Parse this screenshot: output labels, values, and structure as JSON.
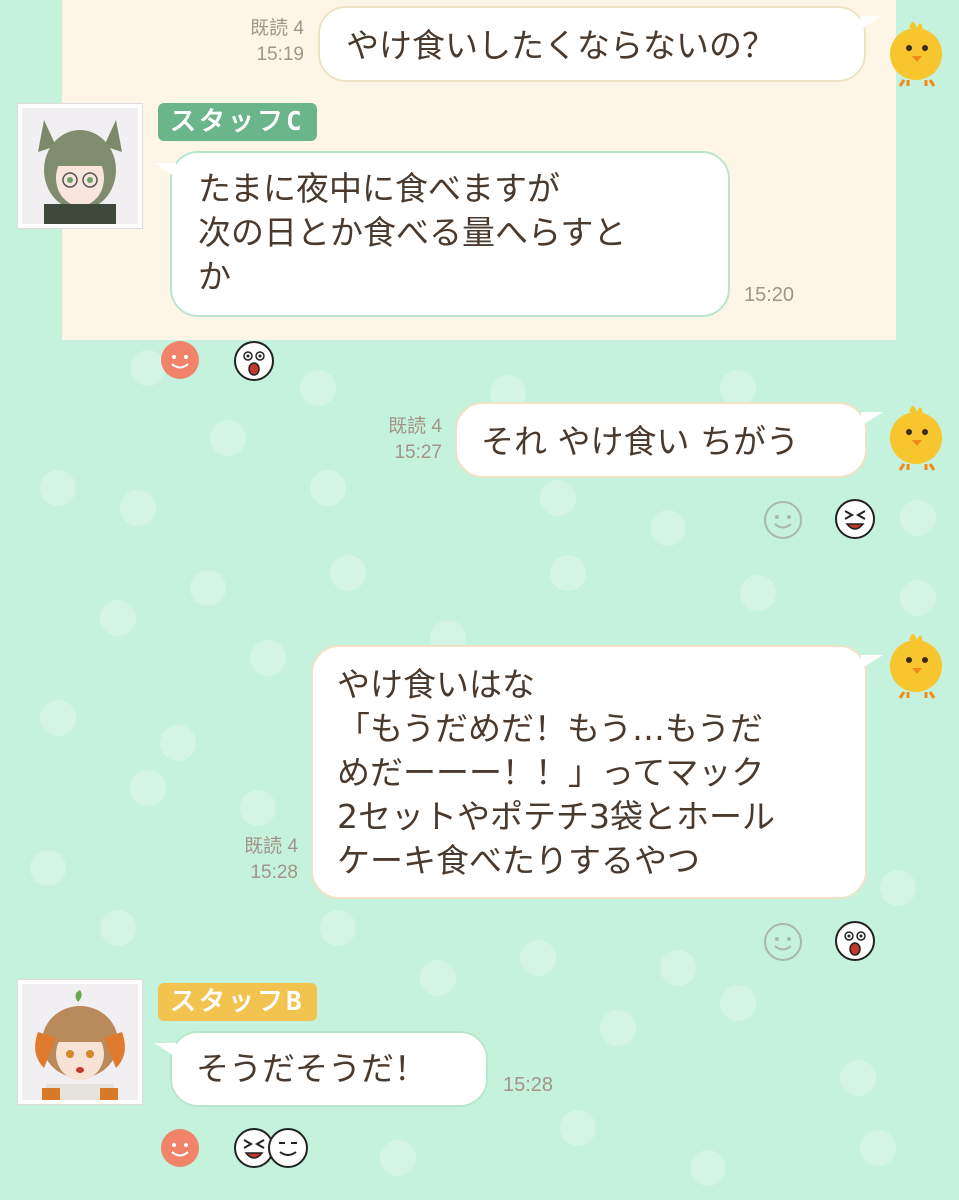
{
  "theme": {
    "background": "#c4f2dc",
    "highlight": "#fdf6e6",
    "bubble": "#ffffff",
    "staff_c_tag": "#6bb58a",
    "staff_b_tag": "#f2c34e",
    "reaction_orange": "#f0836a"
  },
  "messages": [
    {
      "sender": "self",
      "read": "既読 4",
      "time": "15:19",
      "lines": [
        "やけ食いしたくならないの？"
      ]
    },
    {
      "sender": "スタッフC",
      "time": "15:20",
      "lines": [
        "たまに夜中に食べますが",
        "次の日とか食べる量へらすと",
        "か"
      ]
    },
    {
      "sender": "self",
      "read": "既読 4",
      "time": "15:27",
      "lines": [
        "それ やけ食い ちがう"
      ]
    },
    {
      "sender": "self",
      "read": "既読 4",
      "time": "15:28",
      "lines": [
        "やけ食いはな",
        "「もうだめだ！もう…もうだ",
        "めだーーー！！」ってマック",
        "2セットやポテチ3袋とホール",
        "ケーキ食べたりするやつ"
      ]
    },
    {
      "sender": "スタッフB",
      "time": "15:28",
      "lines": [
        "そうだそうだ！"
      ]
    }
  ],
  "reactions": [
    {
      "after": "スタッフC",
      "icons": [
        "smile-icon",
        "shocked-face-icon"
      ]
    },
    {
      "after": "msg-3",
      "icons": [
        "smile-outline-icon",
        "laughing-face-icon"
      ]
    },
    {
      "after": "msg-4",
      "icons": [
        "smile-outline-icon",
        "shocked-face-icon"
      ]
    },
    {
      "after": "スタッフB",
      "icons": [
        "smile-icon",
        "laughing-face-icon",
        "grinning-face-icon"
      ]
    }
  ]
}
